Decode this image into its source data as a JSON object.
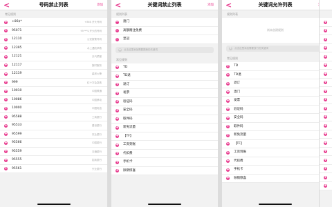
{
  "screen1": {
    "back": "<",
    "title": "号码禁止列表",
    "action": "添加",
    "section": "常见规则",
    "rows": [
      {
        "number": "+86$*",
        "note": "+86$ 开头号码"
      },
      {
        "number": "95071",
        "note": "95***$ 开头的号码"
      },
      {
        "number": "12110",
        "note": "公安报警号码"
      },
      {
        "number": "12395",
        "note": "水上遇险求救"
      },
      {
        "number": "12121",
        "note": "天气预报"
      },
      {
        "number": "12117",
        "note": "报时服务"
      },
      {
        "number": "12119",
        "note": "森林火警"
      },
      {
        "number": "999",
        "note": "红十字会急救"
      },
      {
        "number": "10010",
        "note": "中国联通"
      },
      {
        "number": "10086",
        "note": "中国移动"
      },
      {
        "number": "10000",
        "note": "中国电信"
      },
      {
        "number": "95588",
        "note": "工商银行"
      },
      {
        "number": "95533",
        "note": "建设银行"
      },
      {
        "number": "95599",
        "note": "农业银行"
      },
      {
        "number": "95566",
        "note": "中国银行"
      },
      {
        "number": "95559",
        "note": "交通银行"
      },
      {
        "number": "95555",
        "note": "招商银行"
      },
      {
        "number": "95561",
        "note": "兴业银行"
      }
    ]
  },
  "screen2": {
    "back": "<",
    "title": "关键词禁止列表",
    "action": "添加",
    "section_mine": "规则列表",
    "mine": [
      "澳门",
      "高额赌注免费",
      "皇冠"
    ],
    "add_placeholder": "点击这里添加需要屏蔽的关键词",
    "section_common": "常见规则",
    "common": [
      "TD",
      "TD退",
      "退订",
      "发票",
      "验证码",
      "安全码",
      "取件码",
      "新免流量",
      "【TF】",
      "工资到账",
      "代扣费",
      "手机卡",
      "除销惊喜"
    ]
  },
  "screen3": {
    "back": "<",
    "title": "关键词允许列表",
    "action": "添加",
    "section_mine": "规则列表",
    "empty_text": "尚未创建规则",
    "add_placeholder": "点击这里添加需要放行的关键词",
    "section_common": "常见规则",
    "common": [
      "TD",
      "TD退",
      "退订",
      "澳门",
      "发票",
      "验证码",
      "安全码",
      "取件码",
      "新免流量",
      "【TF】",
      "工资到账",
      "代扣费",
      "手机卡",
      "除销惊喜"
    ]
  },
  "colors": {
    "accent": "#e83c8f",
    "background": "#f2f2f2"
  }
}
